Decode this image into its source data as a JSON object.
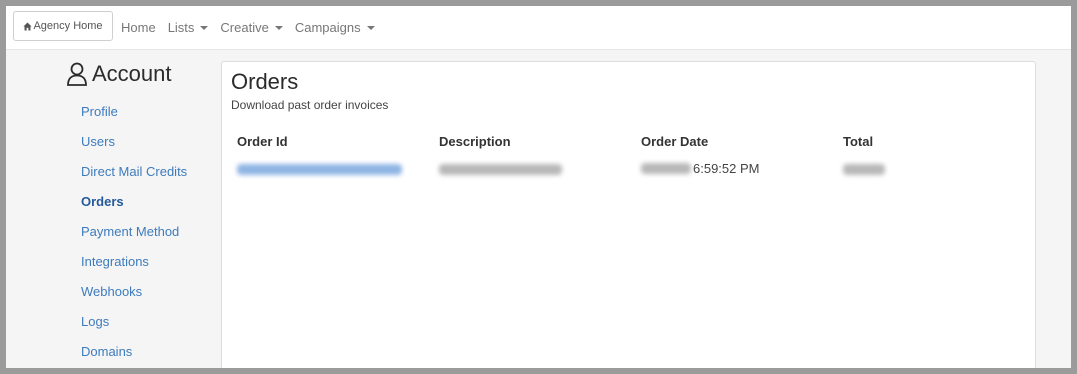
{
  "topnav": {
    "agency_home": "Agency Home",
    "links": [
      {
        "label": "Home",
        "dropdown": false
      },
      {
        "label": "Lists",
        "dropdown": true
      },
      {
        "label": "Creative",
        "dropdown": true
      },
      {
        "label": "Campaigns",
        "dropdown": true
      }
    ]
  },
  "sidebar": {
    "title": "Account",
    "items": [
      {
        "label": "Profile",
        "active": false
      },
      {
        "label": "Users",
        "active": false
      },
      {
        "label": "Direct Mail Credits",
        "active": false
      },
      {
        "label": "Orders",
        "active": true
      },
      {
        "label": "Payment Method",
        "active": false
      },
      {
        "label": "Integrations",
        "active": false
      },
      {
        "label": "Webhooks",
        "active": false
      },
      {
        "label": "Logs",
        "active": false
      },
      {
        "label": "Domains",
        "active": false
      }
    ]
  },
  "orders": {
    "title": "Orders",
    "subtitle": "Download past order invoices",
    "columns": [
      "Order Id",
      "Description",
      "Order Date",
      "Total"
    ],
    "rows": [
      {
        "order_date_visible": "6:59:52 PM"
      }
    ]
  },
  "colors": {
    "link": "#3d7bbd",
    "active_link": "#245a9a",
    "background": "#f5f5f5"
  }
}
